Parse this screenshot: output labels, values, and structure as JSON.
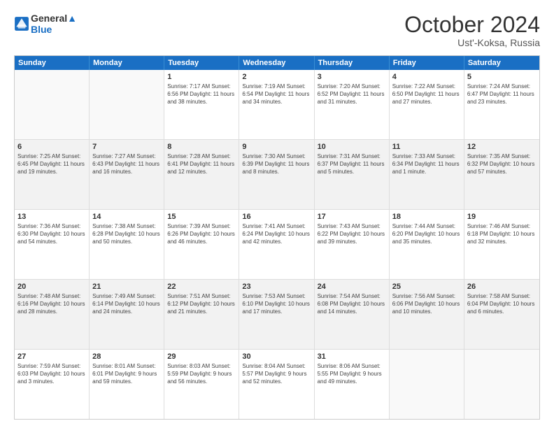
{
  "logo": {
    "line1": "General",
    "line2": "Blue"
  },
  "title": "October 2024",
  "location": "Ust'-Koksa, Russia",
  "days": [
    "Sunday",
    "Monday",
    "Tuesday",
    "Wednesday",
    "Thursday",
    "Friday",
    "Saturday"
  ],
  "weeks": [
    [
      {
        "day": "",
        "info": ""
      },
      {
        "day": "",
        "info": ""
      },
      {
        "day": "1",
        "info": "Sunrise: 7:17 AM\nSunset: 6:56 PM\nDaylight: 11 hours and 38 minutes."
      },
      {
        "day": "2",
        "info": "Sunrise: 7:19 AM\nSunset: 6:54 PM\nDaylight: 11 hours and 34 minutes."
      },
      {
        "day": "3",
        "info": "Sunrise: 7:20 AM\nSunset: 6:52 PM\nDaylight: 11 hours and 31 minutes."
      },
      {
        "day": "4",
        "info": "Sunrise: 7:22 AM\nSunset: 6:50 PM\nDaylight: 11 hours and 27 minutes."
      },
      {
        "day": "5",
        "info": "Sunrise: 7:24 AM\nSunset: 6:47 PM\nDaylight: 11 hours and 23 minutes."
      }
    ],
    [
      {
        "day": "6",
        "info": "Sunrise: 7:25 AM\nSunset: 6:45 PM\nDaylight: 11 hours and 19 minutes."
      },
      {
        "day": "7",
        "info": "Sunrise: 7:27 AM\nSunset: 6:43 PM\nDaylight: 11 hours and 16 minutes."
      },
      {
        "day": "8",
        "info": "Sunrise: 7:28 AM\nSunset: 6:41 PM\nDaylight: 11 hours and 12 minutes."
      },
      {
        "day": "9",
        "info": "Sunrise: 7:30 AM\nSunset: 6:39 PM\nDaylight: 11 hours and 8 minutes."
      },
      {
        "day": "10",
        "info": "Sunrise: 7:31 AM\nSunset: 6:37 PM\nDaylight: 11 hours and 5 minutes."
      },
      {
        "day": "11",
        "info": "Sunrise: 7:33 AM\nSunset: 6:34 PM\nDaylight: 11 hours and 1 minute."
      },
      {
        "day": "12",
        "info": "Sunrise: 7:35 AM\nSunset: 6:32 PM\nDaylight: 10 hours and 57 minutes."
      }
    ],
    [
      {
        "day": "13",
        "info": "Sunrise: 7:36 AM\nSunset: 6:30 PM\nDaylight: 10 hours and 54 minutes."
      },
      {
        "day": "14",
        "info": "Sunrise: 7:38 AM\nSunset: 6:28 PM\nDaylight: 10 hours and 50 minutes."
      },
      {
        "day": "15",
        "info": "Sunrise: 7:39 AM\nSunset: 6:26 PM\nDaylight: 10 hours and 46 minutes."
      },
      {
        "day": "16",
        "info": "Sunrise: 7:41 AM\nSunset: 6:24 PM\nDaylight: 10 hours and 42 minutes."
      },
      {
        "day": "17",
        "info": "Sunrise: 7:43 AM\nSunset: 6:22 PM\nDaylight: 10 hours and 39 minutes."
      },
      {
        "day": "18",
        "info": "Sunrise: 7:44 AM\nSunset: 6:20 PM\nDaylight: 10 hours and 35 minutes."
      },
      {
        "day": "19",
        "info": "Sunrise: 7:46 AM\nSunset: 6:18 PM\nDaylight: 10 hours and 32 minutes."
      }
    ],
    [
      {
        "day": "20",
        "info": "Sunrise: 7:48 AM\nSunset: 6:16 PM\nDaylight: 10 hours and 28 minutes."
      },
      {
        "day": "21",
        "info": "Sunrise: 7:49 AM\nSunset: 6:14 PM\nDaylight: 10 hours and 24 minutes."
      },
      {
        "day": "22",
        "info": "Sunrise: 7:51 AM\nSunset: 6:12 PM\nDaylight: 10 hours and 21 minutes."
      },
      {
        "day": "23",
        "info": "Sunrise: 7:53 AM\nSunset: 6:10 PM\nDaylight: 10 hours and 17 minutes."
      },
      {
        "day": "24",
        "info": "Sunrise: 7:54 AM\nSunset: 6:08 PM\nDaylight: 10 hours and 14 minutes."
      },
      {
        "day": "25",
        "info": "Sunrise: 7:56 AM\nSunset: 6:06 PM\nDaylight: 10 hours and 10 minutes."
      },
      {
        "day": "26",
        "info": "Sunrise: 7:58 AM\nSunset: 6:04 PM\nDaylight: 10 hours and 6 minutes."
      }
    ],
    [
      {
        "day": "27",
        "info": "Sunrise: 7:59 AM\nSunset: 6:03 PM\nDaylight: 10 hours and 3 minutes."
      },
      {
        "day": "28",
        "info": "Sunrise: 8:01 AM\nSunset: 6:01 PM\nDaylight: 9 hours and 59 minutes."
      },
      {
        "day": "29",
        "info": "Sunrise: 8:03 AM\nSunset: 5:59 PM\nDaylight: 9 hours and 56 minutes."
      },
      {
        "day": "30",
        "info": "Sunrise: 8:04 AM\nSunset: 5:57 PM\nDaylight: 9 hours and 52 minutes."
      },
      {
        "day": "31",
        "info": "Sunrise: 8:06 AM\nSunset: 5:55 PM\nDaylight: 9 hours and 49 minutes."
      },
      {
        "day": "",
        "info": ""
      },
      {
        "day": "",
        "info": ""
      }
    ]
  ]
}
